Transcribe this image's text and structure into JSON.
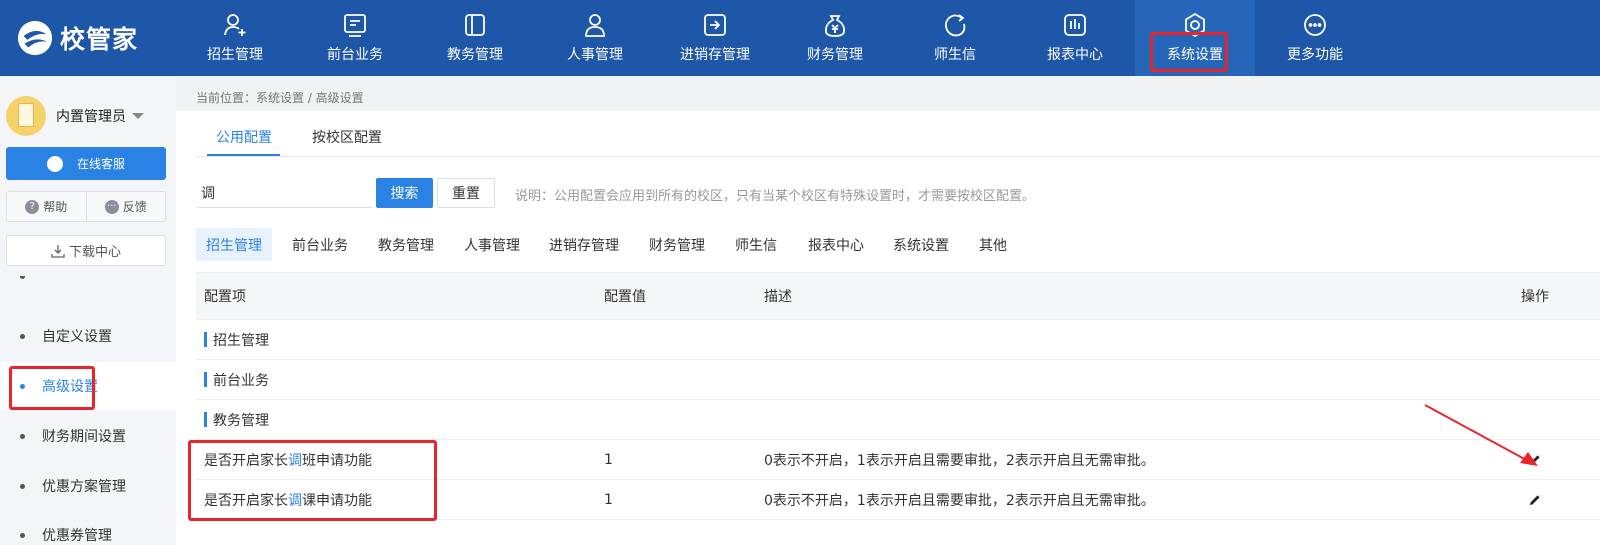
{
  "app": {
    "logo_text": "校管家"
  },
  "nav": [
    {
      "label": "招生管理",
      "icon": "user-add-icon"
    },
    {
      "label": "前台业务",
      "icon": "screen-icon"
    },
    {
      "label": "教务管理",
      "icon": "book-icon"
    },
    {
      "label": "人事管理",
      "icon": "person-icon"
    },
    {
      "label": "进销存管理",
      "icon": "arrow-box-icon"
    },
    {
      "label": "财务管理",
      "icon": "money-bag-icon"
    },
    {
      "label": "师生信",
      "icon": "chat-icon"
    },
    {
      "label": "报表中心",
      "icon": "bar-chart-icon"
    },
    {
      "label": "系统设置",
      "icon": "settings-icon",
      "active": true
    },
    {
      "label": "更多功能",
      "icon": "more-icon"
    }
  ],
  "sidebar": {
    "user_name": "内置管理员",
    "customer_service": "在线客服",
    "help": "帮助",
    "feedback": "反馈",
    "download": "下载中心",
    "menu": [
      {
        "label": "自定义设置"
      },
      {
        "label": "高级设置",
        "active": true
      },
      {
        "label": "财务期间设置"
      },
      {
        "label": "优惠方案管理"
      },
      {
        "label": "优惠券管理"
      }
    ]
  },
  "breadcrumb": "当前位置：系统设置 / 高级设置",
  "tabs": [
    {
      "label": "公用配置",
      "active": true
    },
    {
      "label": "按校区配置"
    }
  ],
  "search": {
    "value": "调",
    "search_label": "搜索",
    "reset_label": "重置"
  },
  "note": "说明：公用配置会应用到所有的校区，只有当某个校区有特殊设置时，才需要按校区配置。",
  "categories": [
    "招生管理",
    "前台业务",
    "教务管理",
    "人事管理",
    "进销存管理",
    "财务管理",
    "师生信",
    "报表中心",
    "系统设置",
    "其他"
  ],
  "table": {
    "headers": {
      "item": "配置项",
      "value": "配置值",
      "desc": "描述",
      "action": "操作"
    },
    "groups": [
      "招生管理",
      "前台业务",
      "教务管理"
    ],
    "rows": [
      {
        "pre": "是否开启家长",
        "hit": "调",
        "post": "班申请功能",
        "value": "1",
        "desc": "0表示不开启，1表示开启且需要审批，2表示开启且无需审批。"
      },
      {
        "pre": "是否开启家长",
        "hit": "调",
        "post": "课申请功能",
        "value": "1",
        "desc": "0表示不开启，1表示开启且需要审批，2表示开启且无需审批。"
      }
    ]
  },
  "colors": {
    "nav_bg": "#1e56a8",
    "accent": "#2a82e4",
    "highlight": "#e8252c"
  }
}
